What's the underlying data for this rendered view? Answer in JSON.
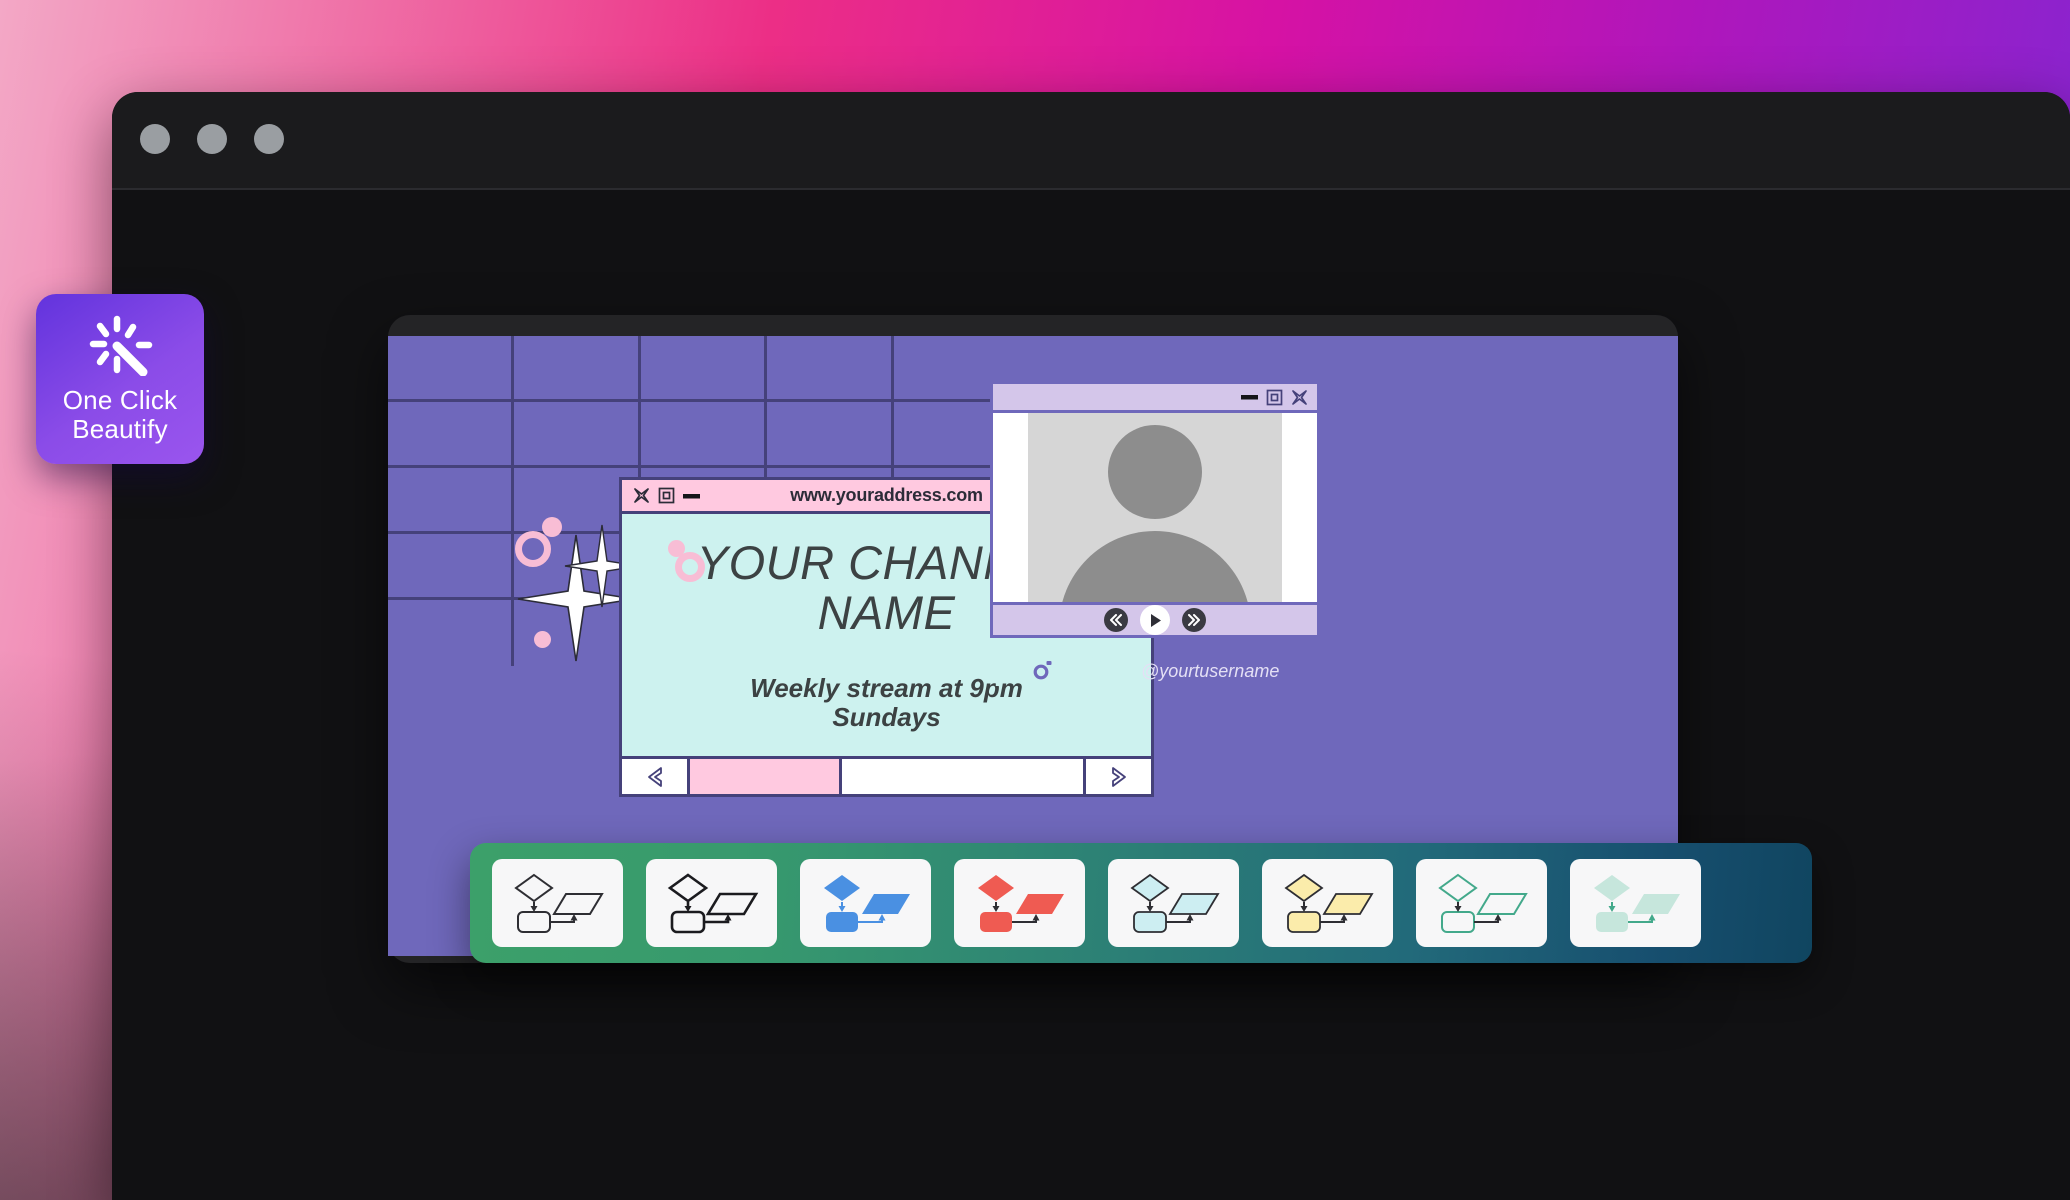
{
  "background": {
    "gradient_from": "#f3a8c6",
    "gradient_mid": "#ec2e86",
    "gradient_to": "#7a2ad6"
  },
  "browser": {
    "traffic_lights": [
      {
        "name": "close",
        "color": "#9a9ea2"
      },
      {
        "name": "minimize",
        "color": "#9a9ea2"
      },
      {
        "name": "maximize",
        "color": "#9a9ea2"
      }
    ],
    "chrome_color": "#1b1b1d",
    "body_color": "#111113"
  },
  "beautify_button": {
    "label_line1": "One Click",
    "label_line2": "Beautify",
    "icon": "magic-sparkle-icon",
    "gradient_from": "#6233dd",
    "gradient_to": "#9a55ee"
  },
  "canvas": {
    "background_color": "#6f68bb",
    "grid": {
      "columns": 5,
      "rows": 5,
      "line_color": "#45417a"
    },
    "decorations": {
      "ring_color": "#f8bdd5",
      "dot_color": "#f8bdd5",
      "sparkle_color": "#ffffff",
      "sparkle_outline": "#2c2c38"
    }
  },
  "retro_window": {
    "url": "www.youraddress.com",
    "title_bar_color": "#ffc9e0",
    "content_color": "#cdf2ef",
    "border_color": "#45417a",
    "buttons": [
      {
        "name": "close-icon",
        "glyph": "X"
      },
      {
        "name": "maximize-icon",
        "glyph": "square"
      },
      {
        "name": "minimize-icon",
        "glyph": "dash"
      }
    ],
    "channel_name": "YOUR CHANNEL NAME",
    "subtitle": "Weekly stream at 9pm Sundays",
    "scrollbar": {
      "left_arrow": "«",
      "right_arrow": "»",
      "thumb_color": "#ffc9e0"
    }
  },
  "avatar_window": {
    "title_bar_color": "#d4c6ea",
    "border_color": "#6f68bb",
    "photo_bg": "#d6d6d6",
    "avatar_color": "#8d8d8d",
    "buttons": [
      {
        "name": "minimize-icon",
        "glyph": "dash"
      },
      {
        "name": "maximize-icon",
        "glyph": "square"
      },
      {
        "name": "close-icon",
        "glyph": "X"
      }
    ],
    "controls": [
      {
        "name": "rewind-button",
        "glyph": "«"
      },
      {
        "name": "play-button",
        "glyph": "▶"
      },
      {
        "name": "forward-button",
        "glyph": "»"
      }
    ]
  },
  "social": {
    "icons": [
      {
        "name": "facebook-icon",
        "color": "#cdf2ef"
      },
      {
        "name": "instagram-icon",
        "color": "#cdf2ef"
      },
      {
        "name": "twitter-icon",
        "color": "#cdf2ef"
      }
    ],
    "handle": "@yourtusername"
  },
  "template_strip": {
    "gradient_from": "#3ca06a",
    "gradient_to": "#104560",
    "thumbnails": [
      {
        "name": "template-outline-dark-1",
        "fill": "none",
        "stroke": "#2e2e33",
        "arrow": "#2e2e33"
      },
      {
        "name": "template-outline-dark-2",
        "fill": "none",
        "stroke": "#1b1b1f",
        "arrow": "#1b1b1f"
      },
      {
        "name": "template-blue",
        "fill": "#4a90e2",
        "stroke": "#4a90e2",
        "arrow": "#4a90e2"
      },
      {
        "name": "template-red",
        "fill": "#ef5b52",
        "stroke": "#2e2e33",
        "arrow": "#2e2e33"
      },
      {
        "name": "template-cyan",
        "fill": "#cdeef2",
        "stroke": "#2e2e33",
        "arrow": "#2e2e33"
      },
      {
        "name": "template-yellow",
        "fill": "#fbecab",
        "stroke": "#2e2e33",
        "arrow": "#2e2e33"
      },
      {
        "name": "template-teal-outline",
        "fill": "none",
        "stroke": "#43a98b",
        "arrow": "#2e2e33"
      },
      {
        "name": "template-green-soft",
        "fill": "#c6e6dc",
        "stroke": "#c6e6dc",
        "arrow": "#43a98b"
      }
    ]
  }
}
